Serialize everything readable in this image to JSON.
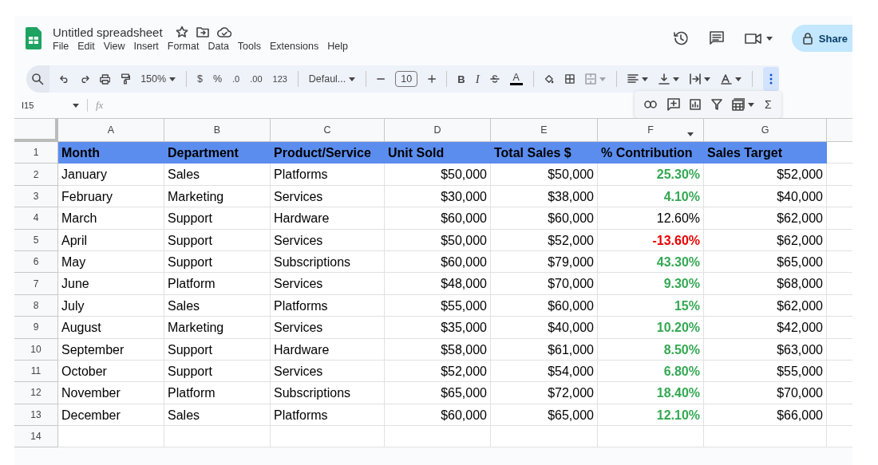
{
  "document": {
    "title": "Untitled spreadsheet"
  },
  "menu": [
    "File",
    "Edit",
    "View",
    "Insert",
    "Format",
    "Data",
    "Tools",
    "Extensions",
    "Help"
  ],
  "share_button": "Share",
  "toolbar": {
    "zoom": "150%",
    "currency": "$",
    "percent": "%",
    "decrease_decimals": ".0",
    "increase_decimals": ".00",
    "number_format": "123",
    "font": "Defaul...",
    "font_size": "10",
    "bold": "B",
    "italic": "I",
    "text_color": "A"
  },
  "more_tools": {
    "sum": "Σ"
  },
  "formula_bar": {
    "cell": "I15",
    "fx": "fx"
  },
  "table": {
    "columns": [
      {
        "label": "A",
        "filter": false
      },
      {
        "label": "B",
        "filter": false
      },
      {
        "label": "C",
        "filter": false
      },
      {
        "label": "D",
        "filter": false
      },
      {
        "label": "E",
        "filter": false
      },
      {
        "label": "F",
        "filter": true
      },
      {
        "label": "G",
        "filter": false
      }
    ],
    "header_row": {
      "number": "1",
      "cells": [
        "Month",
        "Department",
        "Product/Service",
        "Unit Sold",
        "Total Sales $",
        "% Contribution",
        "Sales Target"
      ]
    },
    "rows": [
      {
        "number": "2",
        "cells": [
          "January",
          "Sales",
          "Platforms",
          "$50,000",
          "$50,000",
          "25.30%",
          "$52,000"
        ],
        "color": "#34a853",
        "bold": true
      },
      {
        "number": "3",
        "cells": [
          "February",
          "Marketing",
          "Services",
          "$30,000",
          "$38,000",
          "4.10%",
          "$40,000"
        ],
        "color": "#34a853",
        "bold": true
      },
      {
        "number": "4",
        "cells": [
          "March",
          "Support",
          "Hardware",
          "$60,000",
          "$60,000",
          "12.60%",
          "$62,000"
        ],
        "color": "#000000",
        "bold": false
      },
      {
        "number": "5",
        "cells": [
          "April",
          "Support",
          "Services",
          "$50,000",
          "$52,000",
          "-13.60%",
          "$62,000"
        ],
        "color": "#ea0000",
        "bold": true
      },
      {
        "number": "6",
        "cells": [
          "May",
          "Support",
          "Subscriptions",
          "$60,000",
          "$79,000",
          "43.30%",
          "$65,000"
        ],
        "color": "#34a853",
        "bold": true
      },
      {
        "number": "7",
        "cells": [
          "June",
          "Platform",
          "Services",
          "$48,000",
          "$70,000",
          "9.30%",
          "$68,000"
        ],
        "color": "#34a853",
        "bold": true
      },
      {
        "number": "8",
        "cells": [
          "July",
          "Sales",
          "Platforms",
          "$55,000",
          "$60,000",
          "15%",
          "$62,000"
        ],
        "color": "#34a853",
        "bold": true
      },
      {
        "number": "9",
        "cells": [
          "August",
          "Marketing",
          "Services",
          "$35,000",
          "$40,000",
          "10.20%",
          "$42,000"
        ],
        "color": "#34a853",
        "bold": true
      },
      {
        "number": "10",
        "cells": [
          "September",
          "Support",
          "Hardware",
          "$58,000",
          "$61,000",
          "8.50%",
          "$63,000"
        ],
        "color": "#34a853",
        "bold": true
      },
      {
        "number": "11",
        "cells": [
          "October",
          "Support",
          "Services",
          "$52,000",
          "$54,000",
          "6.80%",
          "$55,000"
        ],
        "color": "#34a853",
        "bold": true
      },
      {
        "number": "12",
        "cells": [
          "November",
          "Platform",
          "Subscriptions",
          "$65,000",
          "$72,000",
          "18.40%",
          "$70,000"
        ],
        "color": "#34a853",
        "bold": true
      },
      {
        "number": "13",
        "cells": [
          "December",
          "Sales",
          "Platforms",
          "$60,000",
          "$65,000",
          "12.10%",
          "$66,000"
        ],
        "color": "#34a853",
        "bold": true
      }
    ],
    "empty_row": {
      "number": "14"
    }
  }
}
